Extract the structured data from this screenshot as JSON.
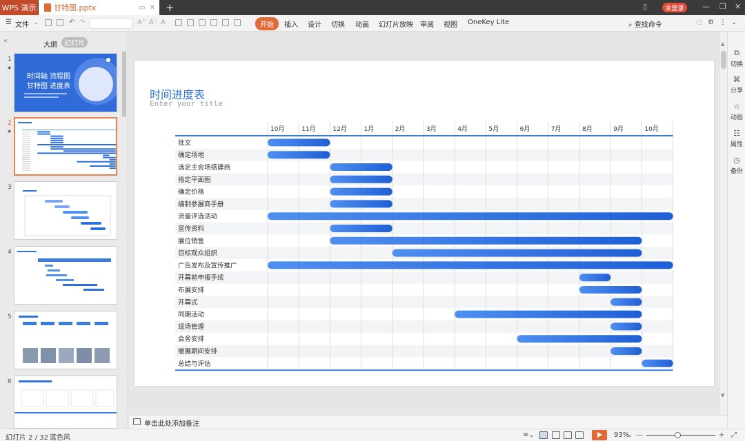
{
  "titlebar": {
    "app_name": "WPS 演示",
    "doc_title": "甘特图.pptx",
    "login_label": "未登录"
  },
  "toolbar": {
    "file_label": "文件",
    "ribbon_tabs": [
      "开始",
      "插入",
      "设计",
      "切换",
      "动画",
      "幻灯片放映",
      "审阅",
      "视图",
      "OneKey Lite"
    ],
    "search_label": "查找命令"
  },
  "leftpanel": {
    "tab_outline": "大纲",
    "tab_slides": "幻灯片",
    "slides": [
      {
        "num": "1",
        "star": true,
        "title_lines": [
          "时间轴 流程图",
          "甘特图 进度表"
        ]
      },
      {
        "num": "2",
        "star": true
      },
      {
        "num": "3",
        "star": false
      },
      {
        "num": "4",
        "star": false
      },
      {
        "num": "5",
        "star": false
      },
      {
        "num": "6",
        "star": false
      }
    ]
  },
  "slide": {
    "title": "时间进度表",
    "subtitle": "Enter your title"
  },
  "chart_data": {
    "type": "gantt",
    "title": "时间进度表",
    "subtitle": "Enter your title",
    "months": [
      "10月",
      "11月",
      "12月",
      "1月",
      "2月",
      "3月",
      "4月",
      "5月",
      "6月",
      "7月",
      "8月",
      "9月",
      "10月"
    ],
    "tasks": [
      {
        "name": "批文",
        "start": 0,
        "end": 2
      },
      {
        "name": "确定场地",
        "start": 0,
        "end": 2
      },
      {
        "name": "选定主会场搭建商",
        "start": 2,
        "end": 4
      },
      {
        "name": "指定平面图",
        "start": 2,
        "end": 4
      },
      {
        "name": "确定价格",
        "start": 2,
        "end": 4
      },
      {
        "name": "编制参展商手册",
        "start": 2,
        "end": 4
      },
      {
        "name": "流量评选活动",
        "start": 0,
        "end": 13
      },
      {
        "name": "宣传资料",
        "start": 2,
        "end": 4
      },
      {
        "name": "展位销售",
        "start": 2,
        "end": 12
      },
      {
        "name": "目标观众组织",
        "start": 4,
        "end": 12
      },
      {
        "name": "广告发布及宣传推广",
        "start": 0,
        "end": 13
      },
      {
        "name": "开幕前申报手续",
        "start": 10,
        "end": 11
      },
      {
        "name": "布展安排",
        "start": 10,
        "end": 12
      },
      {
        "name": "开幕式",
        "start": 11,
        "end": 12
      },
      {
        "name": "同期活动",
        "start": 6,
        "end": 12
      },
      {
        "name": "现场管理",
        "start": 11,
        "end": 12
      },
      {
        "name": "会务安排",
        "start": 8,
        "end": 12
      },
      {
        "name": "撤展期间安排",
        "start": 11,
        "end": 12
      },
      {
        "name": "总结与评估",
        "start": 12,
        "end": 13
      }
    ],
    "colors": {
      "bar_start": "#4f8ff0",
      "bar_end": "#1f5fd6",
      "axis": "#3b7be0",
      "row_alt": "#f3f4f6"
    }
  },
  "rightpanel": {
    "items": [
      {
        "label": "切换",
        "icon": "transition-icon"
      },
      {
        "label": "分享",
        "icon": "share-icon"
      },
      {
        "label": "动画",
        "icon": "animation-icon"
      },
      {
        "label": "属性",
        "icon": "properties-icon"
      },
      {
        "label": "备份",
        "icon": "backup-icon"
      }
    ]
  },
  "notes": {
    "placeholder": "单击此处添加备注"
  },
  "statusbar": {
    "slide_info": "幻灯片 2 / 32",
    "theme": "蓝色风",
    "zoom": "93%"
  },
  "colors": {
    "accent": "#e26a35",
    "brand_red": "#c54a2a",
    "chart_blue": "#2e72e0"
  }
}
